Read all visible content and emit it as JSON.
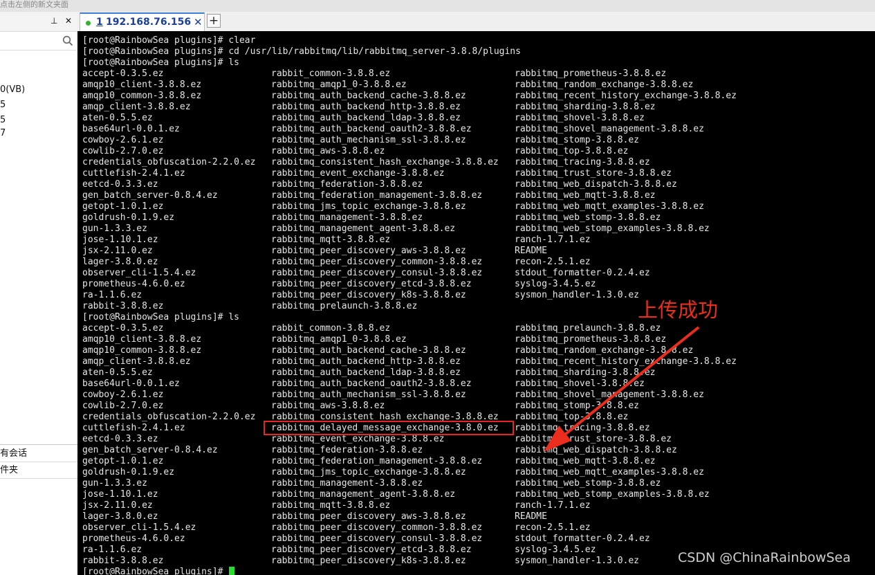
{
  "top_strip_text": "点击左侧的新文夹面",
  "left_panel": {
    "pin_glyph": "⊥",
    "close_glyph": "✕",
    "tree_items": [
      "0(VB)",
      "5",
      "5",
      "7"
    ],
    "bottom_items": [
      "有会话",
      "件夹"
    ]
  },
  "tab": {
    "number": "1",
    "title": "192.168.76.156",
    "close_glyph": "✕",
    "new_tab_glyph": "+"
  },
  "terminal": {
    "prompt": "[root@RainbowSea plugins]# ",
    "lines": [
      {
        "type": "cmd",
        "text": "[root@RainbowSea plugins]# clear"
      },
      {
        "type": "cmd",
        "text": "[root@RainbowSea plugins]# cd /usr/lib/rabbitmq/lib/rabbitmq_server-3.8.8/plugins"
      },
      {
        "type": "cmd",
        "text": "[root@RainbowSea plugins]# ls"
      },
      {
        "type": "row",
        "cols": [
          "accept-0.3.5.ez",
          "rabbit_common-3.8.8.ez",
          "rabbitmq_prometheus-3.8.8.ez"
        ]
      },
      {
        "type": "row",
        "cols": [
          "amqp10_client-3.8.8.ez",
          "rabbitmq_amqp1_0-3.8.8.ez",
          "rabbitmq_random_exchange-3.8.8.ez"
        ]
      },
      {
        "type": "row",
        "cols": [
          "amqp10_common-3.8.8.ez",
          "rabbitmq_auth_backend_cache-3.8.8.ez",
          "rabbitmq_recent_history_exchange-3.8.8.ez"
        ]
      },
      {
        "type": "row",
        "cols": [
          "amqp_client-3.8.8.ez",
          "rabbitmq_auth_backend_http-3.8.8.ez",
          "rabbitmq_sharding-3.8.8.ez"
        ]
      },
      {
        "type": "row",
        "cols": [
          "aten-0.5.5.ez",
          "rabbitmq_auth_backend_ldap-3.8.8.ez",
          "rabbitmq_shovel-3.8.8.ez"
        ]
      },
      {
        "type": "row",
        "cols": [
          "base64url-0.0.1.ez",
          "rabbitmq_auth_backend_oauth2-3.8.8.ez",
          "rabbitmq_shovel_management-3.8.8.ez"
        ]
      },
      {
        "type": "row",
        "cols": [
          "cowboy-2.6.1.ez",
          "rabbitmq_auth_mechanism_ssl-3.8.8.ez",
          "rabbitmq_stomp-3.8.8.ez"
        ]
      },
      {
        "type": "row",
        "cols": [
          "cowlib-2.7.0.ez",
          "rabbitmq_aws-3.8.8.ez",
          "rabbitmq_top-3.8.8.ez"
        ]
      },
      {
        "type": "row",
        "cols": [
          "credentials_obfuscation-2.2.0.ez",
          "rabbitmq_consistent_hash_exchange-3.8.8.ez",
          "rabbitmq_tracing-3.8.8.ez"
        ]
      },
      {
        "type": "row",
        "cols": [
          "cuttlefish-2.4.1.ez",
          "rabbitmq_event_exchange-3.8.8.ez",
          "rabbitmq_trust_store-3.8.8.ez"
        ]
      },
      {
        "type": "row",
        "cols": [
          "eetcd-0.3.3.ez",
          "rabbitmq_federation-3.8.8.ez",
          "rabbitmq_web_dispatch-3.8.8.ez"
        ]
      },
      {
        "type": "row",
        "cols": [
          "gen_batch_server-0.8.4.ez",
          "rabbitmq_federation_management-3.8.8.ez",
          "rabbitmq_web_mqtt-3.8.8.ez"
        ]
      },
      {
        "type": "row",
        "cols": [
          "getopt-1.0.1.ez",
          "rabbitmq_jms_topic_exchange-3.8.8.ez",
          "rabbitmq_web_mqtt_examples-3.8.8.ez"
        ]
      },
      {
        "type": "row",
        "cols": [
          "goldrush-0.1.9.ez",
          "rabbitmq_management-3.8.8.ez",
          "rabbitmq_web_stomp-3.8.8.ez"
        ]
      },
      {
        "type": "row",
        "cols": [
          "gun-1.3.3.ez",
          "rabbitmq_management_agent-3.8.8.ez",
          "rabbitmq_web_stomp_examples-3.8.8.ez"
        ]
      },
      {
        "type": "row",
        "cols": [
          "jose-1.10.1.ez",
          "rabbitmq_mqtt-3.8.8.ez",
          "ranch-1.7.1.ez"
        ]
      },
      {
        "type": "row",
        "cols": [
          "jsx-2.11.0.ez",
          "rabbitmq_peer_discovery_aws-3.8.8.ez",
          "README"
        ]
      },
      {
        "type": "row",
        "cols": [
          "lager-3.8.0.ez",
          "rabbitmq_peer_discovery_common-3.8.8.ez",
          "recon-2.5.1.ez"
        ]
      },
      {
        "type": "row",
        "cols": [
          "observer_cli-1.5.4.ez",
          "rabbitmq_peer_discovery_consul-3.8.8.ez",
          "stdout_formatter-0.2.4.ez"
        ]
      },
      {
        "type": "row",
        "cols": [
          "prometheus-4.6.0.ez",
          "rabbitmq_peer_discovery_etcd-3.8.8.ez",
          "syslog-3.4.5.ez"
        ]
      },
      {
        "type": "row",
        "cols": [
          "ra-1.1.6.ez",
          "rabbitmq_peer_discovery_k8s-3.8.8.ez",
          "sysmon_handler-1.3.0.ez"
        ]
      },
      {
        "type": "row",
        "cols": [
          "rabbit-3.8.8.ez",
          "rabbitmq_prelaunch-3.8.8.ez",
          ""
        ]
      },
      {
        "type": "cmd",
        "text": "[root@RainbowSea plugins]# ls"
      },
      {
        "type": "row",
        "cols": [
          "accept-0.3.5.ez",
          "rabbit_common-3.8.8.ez",
          "rabbitmq_prelaunch-3.8.8.ez"
        ]
      },
      {
        "type": "row",
        "cols": [
          "amqp10_client-3.8.8.ez",
          "rabbitmq_amqp1_0-3.8.8.ez",
          "rabbitmq_prometheus-3.8.8.ez"
        ]
      },
      {
        "type": "row",
        "cols": [
          "amqp10_common-3.8.8.ez",
          "rabbitmq_auth_backend_cache-3.8.8.ez",
          "rabbitmq_random_exchange-3.8.8.ez"
        ]
      },
      {
        "type": "row",
        "cols": [
          "amqp_client-3.8.8.ez",
          "rabbitmq_auth_backend_http-3.8.8.ez",
          "rabbitmq_recent_history_exchange-3.8.8.ez"
        ]
      },
      {
        "type": "row",
        "cols": [
          "aten-0.5.5.ez",
          "rabbitmq_auth_backend_ldap-3.8.8.ez",
          "rabbitmq_sharding-3.8.8.ez"
        ]
      },
      {
        "type": "row",
        "cols": [
          "base64url-0.0.1.ez",
          "rabbitmq_auth_backend_oauth2-3.8.8.ez",
          "rabbitmq_shovel-3.8.8.ez"
        ]
      },
      {
        "type": "row",
        "cols": [
          "cowboy-2.6.1.ez",
          "rabbitmq_auth_mechanism_ssl-3.8.8.ez",
          "rabbitmq_shovel_management-3.8.8.ez"
        ]
      },
      {
        "type": "row",
        "cols": [
          "cowlib-2.7.0.ez",
          "rabbitmq_aws-3.8.8.ez",
          "rabbitmq_stomp-3.8.8.ez"
        ]
      },
      {
        "type": "row",
        "cols": [
          "credentials_obfuscation-2.2.0.ez",
          "rabbitmq_consistent_hash_exchange-3.8.8.ez",
          "rabbitmq_top-3.8.8.ez"
        ]
      },
      {
        "type": "row",
        "cols": [
          "cuttlefish-2.4.1.ez",
          "rabbitmq_delayed_message_exchange-3.8.0.ez",
          "rabbitmq_tracing-3.8.8.ez"
        ]
      },
      {
        "type": "row",
        "cols": [
          "eetcd-0.3.3.ez",
          "rabbitmq_event_exchange-3.8.8.ez",
          "rabbitmq_trust_store-3.8.8.ez"
        ]
      },
      {
        "type": "row",
        "cols": [
          "gen_batch_server-0.8.4.ez",
          "rabbitmq_federation-3.8.8.ez",
          "rabbitmq_web_dispatch-3.8.8.ez"
        ]
      },
      {
        "type": "row",
        "cols": [
          "getopt-1.0.1.ez",
          "rabbitmq_federation_management-3.8.8.ez",
          "rabbitmq_web_mqtt-3.8.8.ez"
        ]
      },
      {
        "type": "row",
        "cols": [
          "goldrush-0.1.9.ez",
          "rabbitmq_jms_topic_exchange-3.8.8.ez",
          "rabbitmq_web_mqtt_examples-3.8.8.ez"
        ]
      },
      {
        "type": "row",
        "cols": [
          "gun-1.3.3.ez",
          "rabbitmq_management-3.8.8.ez",
          "rabbitmq_web_stomp-3.8.8.ez"
        ]
      },
      {
        "type": "row",
        "cols": [
          "jose-1.10.1.ez",
          "rabbitmq_management_agent-3.8.8.ez",
          "rabbitmq_web_stomp_examples-3.8.8.ez"
        ]
      },
      {
        "type": "row",
        "cols": [
          "jsx-2.11.0.ez",
          "rabbitmq_mqtt-3.8.8.ez",
          "ranch-1.7.1.ez"
        ]
      },
      {
        "type": "row",
        "cols": [
          "lager-3.8.0.ez",
          "rabbitmq_peer_discovery_aws-3.8.8.ez",
          "README"
        ]
      },
      {
        "type": "row",
        "cols": [
          "observer_cli-1.5.4.ez",
          "rabbitmq_peer_discovery_common-3.8.8.ez",
          "recon-2.5.1.ez"
        ]
      },
      {
        "type": "row",
        "cols": [
          "prometheus-4.6.0.ez",
          "rabbitmq_peer_discovery_consul-3.8.8.ez",
          "stdout_formatter-0.2.4.ez"
        ]
      },
      {
        "type": "row",
        "cols": [
          "ra-1.1.6.ez",
          "rabbitmq_peer_discovery_etcd-3.8.8.ez",
          "syslog-3.4.5.ez"
        ]
      },
      {
        "type": "row",
        "cols": [
          "rabbit-3.8.8.ez",
          "rabbitmq_peer_discovery_k8s-3.8.8.ez",
          "sysmon_handler-1.3.0.ez"
        ]
      }
    ]
  },
  "annotation": {
    "text": "上传成功",
    "color": "#ea2d1c"
  },
  "watermark": "CSDN @ChinaRainbowSea",
  "colors": {
    "terminal_bg": "#000000",
    "terminal_fg": "#e6e6e6",
    "cursor": "#25e02b",
    "highlight_box": "#e8242a"
  },
  "icons": {
    "search": "search-icon",
    "pin": "pin-icon",
    "close": "close-icon",
    "status_dot": "connected-status-icon"
  }
}
